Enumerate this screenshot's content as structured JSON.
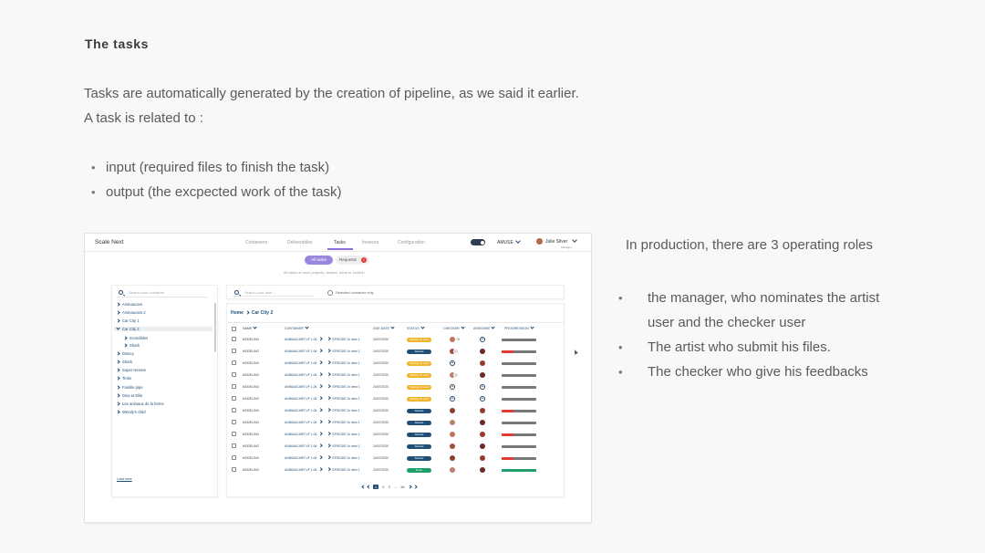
{
  "heading": "The tasks",
  "intro": {
    "line1": "Tasks are automatically generated by the creation of pipeline, as we said it earlier.",
    "line2": "A task is related to :",
    "bullets": [
      "input (required files to finish the task)",
      "output (the excpected work of the task)"
    ]
  },
  "roles": {
    "title": "In production, there are 3 operating roles",
    "items": [
      "the manager, who nominates the artist user and the checker user",
      "The artist who submit his files.",
      "The checker who give his feedbacks"
    ]
  },
  "app": {
    "brand": "Scale Next",
    "nav": [
      "Containers",
      "Deliverables",
      "Tasks",
      "Invoices",
      "Configuration"
    ],
    "active_nav": "Tasks",
    "org": "AMUSE",
    "user_name": "Julie Silver",
    "user_role": "Manager",
    "tabs": {
      "all": "All tasks",
      "requests": "Requests",
      "requests_count": "2"
    },
    "subtitle": "All tasks of each projects, started, done or locked !",
    "sidebar": {
      "search_placeholder": "Search your container",
      "items": [
        {
          "label": "Animaucars"
        },
        {
          "label": "Animaucars 2"
        },
        {
          "label": "Car City 1"
        },
        {
          "label": "Car City 2",
          "selected": true
        },
        {
          "label": "Incredibles",
          "sub": true
        },
        {
          "label": "Shark",
          "sub": true
        },
        {
          "label": "Disney"
        },
        {
          "label": "Shark"
        },
        {
          "label": "Super Heroes"
        },
        {
          "label": "Tintin"
        },
        {
          "label": "Famille pipe"
        },
        {
          "label": "Dina et Ellie"
        },
        {
          "label": "Les animaux de la ferme"
        },
        {
          "label": "Wendy's child"
        }
      ],
      "load_more": "Load more"
    },
    "task_search_placeholder": "Search your task ...",
    "selected_only_label": "Selected container only",
    "breadcrumb": [
      "Home",
      "Car City 2"
    ],
    "columns": [
      "NAME",
      "CONTAINER",
      "DUE DATE",
      "STATUS",
      "CHECKER",
      "ASSIGNEE",
      "PROGRESSION"
    ],
    "rows": [
      {
        "name": "MODELING",
        "container": "ANIMAUCARS VF 1.06",
        "episode": "EPISODE 2x view 1",
        "due": "24/07/2020",
        "status": "Waiting for start",
        "status_color": "#f0b429",
        "checker": "avatar",
        "checker_extra": "+2",
        "assignee": "add",
        "progress": 0.0,
        "progress_color": "#e53935"
      },
      {
        "name": "MODELING",
        "container": "ANIMAUCARS VF 1.06",
        "episode": "EPISODE 2x view 1",
        "due": "24/07/2020",
        "status": "Started",
        "status_color": "#1f4f77",
        "checker": "avatar-pair",
        "checker_extra": "",
        "assignee": "avatar",
        "progress": 0.35,
        "progress_color": "#e53935"
      },
      {
        "name": "MODELING",
        "container": "ANIMAUCARS VF 1.06",
        "episode": "EPISODE 2x view 1",
        "due": "24/07/2020",
        "status": "Waiting for start",
        "status_color": "#f0b429",
        "checker": "add",
        "checker_extra": "",
        "assignee": "avatar",
        "progress": 0.0,
        "progress_color": "#e53935"
      },
      {
        "name": "MODELING",
        "container": "ANIMAUCARS VF 1.06",
        "episode": "EPISODE 2x view 1",
        "due": "24/07/2020",
        "status": "Waiting for start",
        "status_color": "#f0b429",
        "checker": "avatar-pair",
        "checker_extra": "",
        "assignee": "avatar",
        "progress": 0.0,
        "progress_color": "#e53935"
      },
      {
        "name": "MODELING",
        "container": "ANIMAUCARS VF 1.06",
        "episode": "EPISODE 2x view 1",
        "due": "24/07/2020",
        "status": "Waiting for start",
        "status_color": "#f0b429",
        "checker": "add",
        "checker_extra": "",
        "assignee": "add",
        "progress": 0.0,
        "progress_color": "#e53935"
      },
      {
        "name": "MODELING",
        "container": "ANIMAUCARS VF 1.06",
        "episode": "EPISODE 2x view 1",
        "due": "24/07/2020",
        "status": "Waiting for start",
        "status_color": "#f0b429",
        "checker": "add",
        "checker_extra": "",
        "assignee": "add",
        "progress": 0.0,
        "progress_color": "#e53935"
      },
      {
        "name": "MODELING",
        "container": "ANIMAUCARS VF 1.06",
        "episode": "EPISODE 2x view 1",
        "due": "24/07/2020",
        "status": "Started",
        "status_color": "#1f4f77",
        "checker": "avatar",
        "checker_extra": "",
        "assignee": "avatar",
        "progress": 0.35,
        "progress_color": "#e53935"
      },
      {
        "name": "MODELING",
        "container": "ANIMAUCARS VF 1.06",
        "episode": "EPISODE 2x view 1",
        "due": "24/07/2020",
        "status": "Started",
        "status_color": "#1f4f77",
        "checker": "avatar",
        "checker_extra": "",
        "assignee": "avatar",
        "progress": 0.0,
        "progress_color": "#e53935"
      },
      {
        "name": "MODELING",
        "container": "ANIMAUCARS VF 1.06",
        "episode": "EPISODE 2x view 1",
        "due": "24/07/2020",
        "status": "Started",
        "status_color": "#1f4f77",
        "checker": "avatar",
        "checker_extra": "",
        "assignee": "avatar",
        "progress": 0.35,
        "progress_color": "#e53935"
      },
      {
        "name": "MODELING",
        "container": "ANIMAUCARS VF 1.06",
        "episode": "EPISODE 2x view 1",
        "due": "24/07/2020",
        "status": "Started",
        "status_color": "#1f4f77",
        "checker": "avatar",
        "checker_extra": "",
        "assignee": "avatar",
        "progress": 0.0,
        "progress_color": "#e53935"
      },
      {
        "name": "MODELING",
        "container": "ANIMAUCARS VF 1.06",
        "episode": "EPISODE 2x view 1",
        "due": "24/07/2020",
        "status": "Started",
        "status_color": "#1f4f77",
        "checker": "avatar",
        "checker_extra": "",
        "assignee": "avatar",
        "progress": 0.35,
        "progress_color": "#e53935"
      },
      {
        "name": "MODELING",
        "container": "ANIMAUCARS VF 1.06",
        "episode": "EPISODE 2x view 1",
        "due": "24/07/2020",
        "status": "Done",
        "status_color": "#1e9e6a",
        "checker": "avatar",
        "checker_extra": "",
        "assignee": "avatar",
        "progress": 1.0,
        "progress_color": "#1e9e6a"
      }
    ],
    "pager": {
      "pages": [
        "1",
        "2",
        "3",
        "...",
        "18"
      ],
      "current": "1"
    }
  },
  "colors": {
    "accent": "#9a86dc",
    "brand_blue": "#1f4f77",
    "warning": "#f0b429",
    "danger": "#e53935",
    "success": "#1e9e6a"
  }
}
